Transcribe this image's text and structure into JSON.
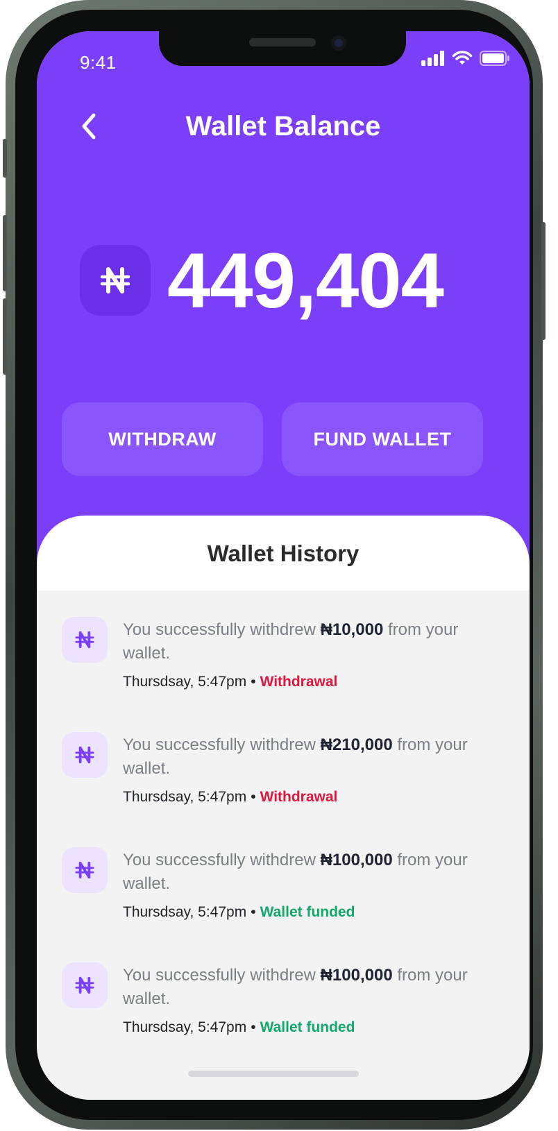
{
  "status_bar": {
    "time": "9:41"
  },
  "header": {
    "title": "Wallet Balance",
    "back_icon": "chevron-left-icon"
  },
  "balance": {
    "currency_symbol": "₦",
    "amount": "449,404"
  },
  "actions": {
    "withdraw_label": "WITHDRAW",
    "fund_label": "FUND WALLET"
  },
  "history": {
    "title": "Wallet History",
    "items": [
      {
        "prefix": "You successfully withdrew ",
        "amount": "₦10,000",
        "suffix": " from your wallet.",
        "time": "Thursdsay, 5:47pm",
        "separator": "•",
        "status": "Withdrawal",
        "status_color": "#e0163f"
      },
      {
        "prefix": "You successfully withdrew ",
        "amount": "₦210,000",
        "suffix": " from your wallet.",
        "time": "Thursdsay, 5:47pm",
        "separator": "•",
        "status": "Withdrawal",
        "status_color": "#e0163f"
      },
      {
        "prefix": "You successfully withdrew ",
        "amount": "₦100,000",
        "suffix": " from your wallet.",
        "time": "Thursdsay, 5:47pm",
        "separator": "•",
        "status": "Wallet funded",
        "status_color": "#12a86b"
      },
      {
        "prefix": "You successfully withdrew ",
        "amount": "₦100,000",
        "suffix": " from your wallet.",
        "time": "Thursdsay, 5:47pm",
        "separator": "•",
        "status": "Wallet funded",
        "status_color": "#12a86b"
      }
    ]
  },
  "colors": {
    "accent": "#7b3ff9",
    "button": "#8a55fb",
    "withdrawal": "#e0163f",
    "funded": "#12a86b"
  }
}
